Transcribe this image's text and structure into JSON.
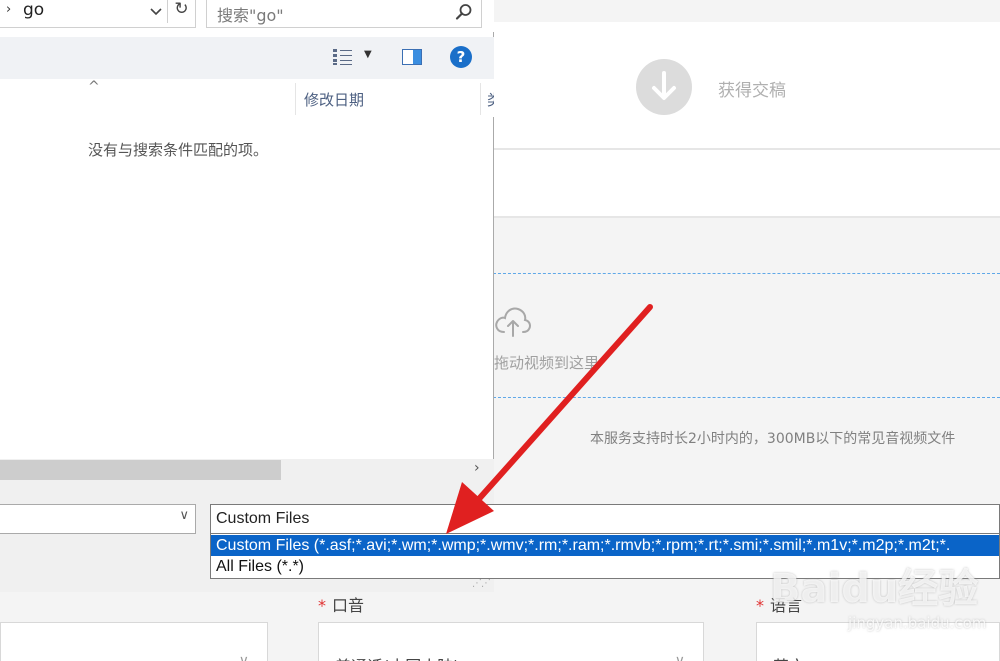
{
  "background_page": {
    "step_label": "获得交稿",
    "upload_text": "拖动视频到这里",
    "support_text": "本服务支持时长2小时内的，300MB以下的常见音视频文件",
    "accent_label": "口音",
    "language_label": "语言",
    "required_mark": "*",
    "accent_value": "普通话(中国大陆)",
    "language_value": "英文"
  },
  "dialog": {
    "address": "go",
    "search_placeholder": "搜索\"go\"",
    "column_modified": "修改日期",
    "column_type": "类",
    "empty_message": "没有与搜索条件匹配的项。",
    "file_type_selected": "Custom Files",
    "file_type_options": [
      "Custom Files (*.asf;*.avi;*.wm;*.wmp;*.wmv;*.rm;*.ram;*.rmvb;*.rpm;*.rt;*.smi;*.smil;*.m1v;*.m2p;*.m2t;*.",
      "All Files (*.*)"
    ]
  },
  "watermark": {
    "brand": "Baidu经验",
    "url": "jingyan.baidu.com"
  },
  "colors": {
    "selection": "#0a64c8",
    "arrow": "#e02020",
    "help": "#1a6fc9",
    "required": "#e03030"
  }
}
